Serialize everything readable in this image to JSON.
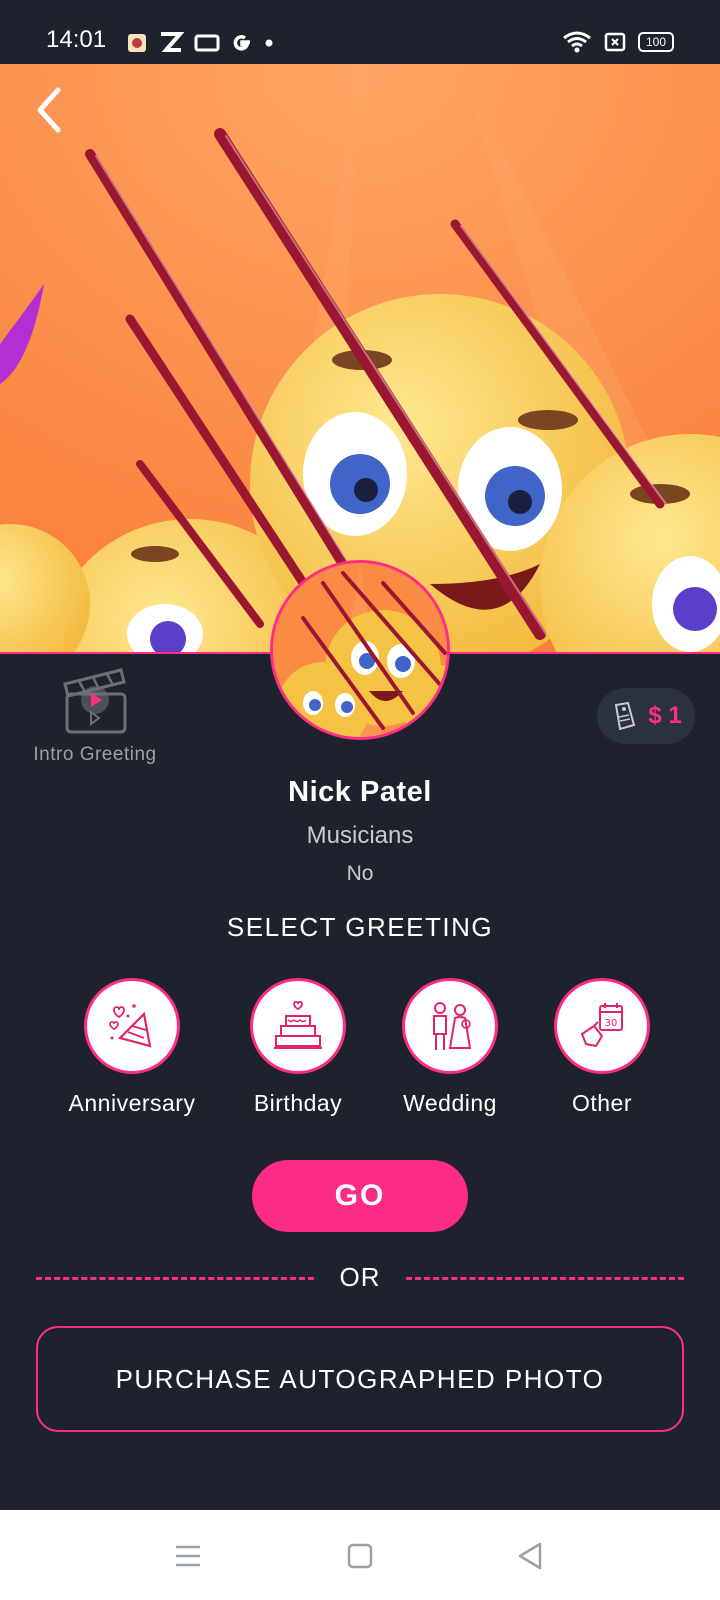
{
  "status_bar": {
    "time": "14:01",
    "battery": "100",
    "left_icons": [
      "app-notification-icon",
      "z-app-icon",
      "screen-cast-icon",
      "google-icon",
      "dot-icon"
    ],
    "right_icons": [
      "wifi-icon",
      "sim-icon",
      "battery-icon"
    ]
  },
  "header": {
    "back_icon": "chevron-left-icon"
  },
  "profile": {
    "intro_label": "Intro Greeting",
    "price": "$ 1",
    "name": "Nick Patel",
    "category": "Musicians",
    "subtext": "No"
  },
  "greeting": {
    "title": "SELECT GREETING",
    "options": [
      {
        "label": "Anniversary",
        "icon": "party-popper-icon"
      },
      {
        "label": "Birthday",
        "icon": "cake-icon"
      },
      {
        "label": "Wedding",
        "icon": "couple-icon"
      },
      {
        "label": "Other",
        "icon": "calendar-icon"
      }
    ]
  },
  "actions": {
    "go_label": "GO",
    "or_label": "OR",
    "purchase_label": "PURCHASE AUTOGRAPHED PHOTO"
  },
  "colors": {
    "background": "#1e222c",
    "accent": "#fc2b85",
    "banner": "#fb8a45"
  }
}
